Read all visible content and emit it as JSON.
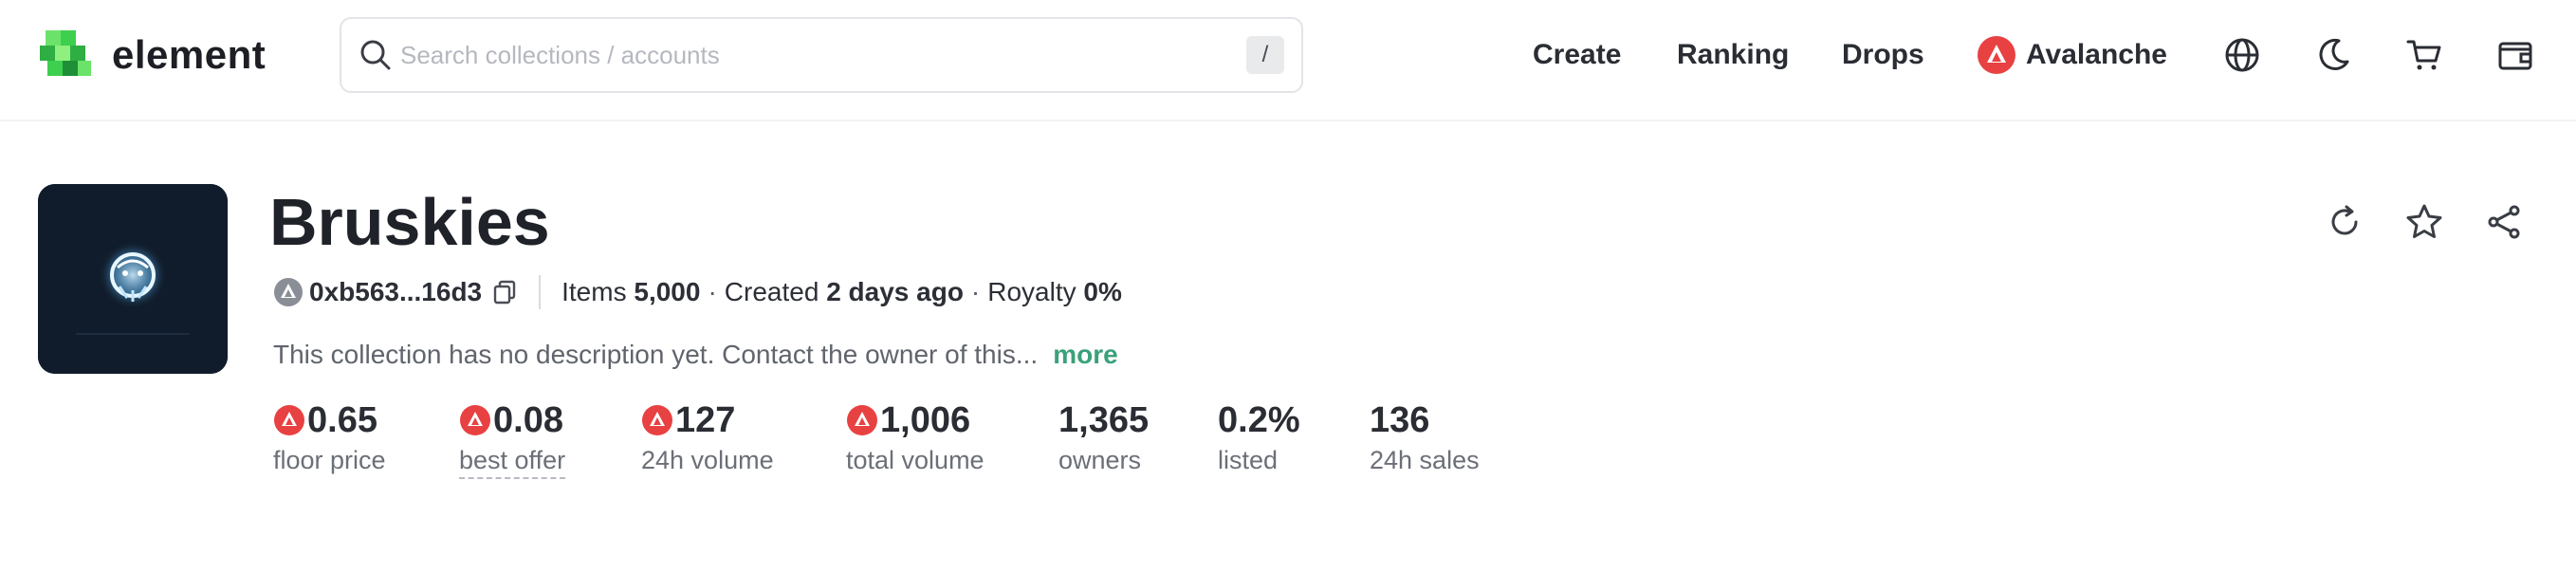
{
  "header": {
    "logo_text": "element",
    "search": {
      "placeholder": "Search collections / accounts",
      "shortcut": "/"
    },
    "nav": {
      "create": "Create",
      "ranking": "Ranking",
      "drops": "Drops",
      "chain": "Avalanche"
    },
    "icons": [
      "globe-icon",
      "moon-icon",
      "cart-icon",
      "wallet-icon"
    ]
  },
  "collection": {
    "name": "Bruskies",
    "address": "0xb563...16d3",
    "items_label": "Items",
    "items_value": "5,000",
    "created_label": "Created",
    "created_value": "2 days ago",
    "royalty_label": "Royalty",
    "royalty_value": "0%",
    "description": "This collection has no description yet. Contact the owner of this...",
    "more_label": "more",
    "stats": [
      {
        "value": "0.65",
        "label": "floor price"
      },
      {
        "value": "0.08",
        "label": "best offer"
      },
      {
        "value": "127",
        "label": "24h volume"
      },
      {
        "value": "1,006",
        "label": "total volume"
      },
      {
        "value": "1,365",
        "label": "owners"
      },
      {
        "value": "0.2%",
        "label": "listed"
      },
      {
        "value": "136",
        "label": "24h sales"
      }
    ]
  },
  "colors": {
    "avax_red": "#e84142",
    "accent_green": "#3aa17a",
    "logo_green": "#3ecf4f"
  }
}
